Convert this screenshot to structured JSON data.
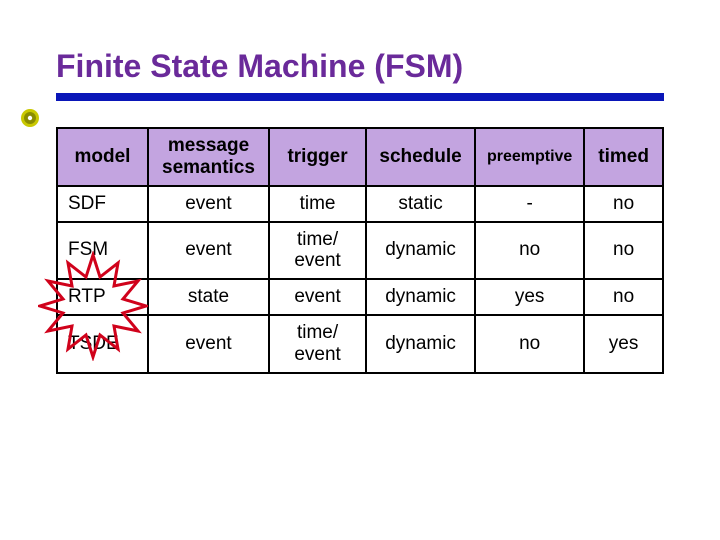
{
  "title": "Finite State Machine (FSM)",
  "headers": {
    "model": "model",
    "message_semantics": "message\nsemantics",
    "trigger": "trigger",
    "schedule": "schedule",
    "preemptive": "preemptive",
    "timed": "timed"
  },
  "rows": [
    {
      "model": "SDF",
      "message_semantics": "event",
      "trigger": "time",
      "schedule": "static",
      "preemptive": "-",
      "timed": "no"
    },
    {
      "model": "FSM",
      "message_semantics": "event",
      "trigger": "time/\nevent",
      "schedule": "dynamic",
      "preemptive": "no",
      "timed": "no"
    },
    {
      "model": "RTP",
      "message_semantics": "state",
      "trigger": "event",
      "schedule": "dynamic",
      "preemptive": "yes",
      "timed": "no"
    },
    {
      "model": "TSDE",
      "message_semantics": "event",
      "trigger": "time/\nevent",
      "schedule": "dynamic",
      "preemptive": "no",
      "timed": "yes"
    }
  ],
  "highlight_row_model": "FSM",
  "colors": {
    "title": "#6a2a9a",
    "underline": "#0a16b8",
    "header_bg": "#c3a4e0",
    "bullet_outer": "#c9c800",
    "bullet_inner": "#8a8c00",
    "bullet_dot": "#ffffff",
    "starburst_stroke": "#d0021b"
  }
}
